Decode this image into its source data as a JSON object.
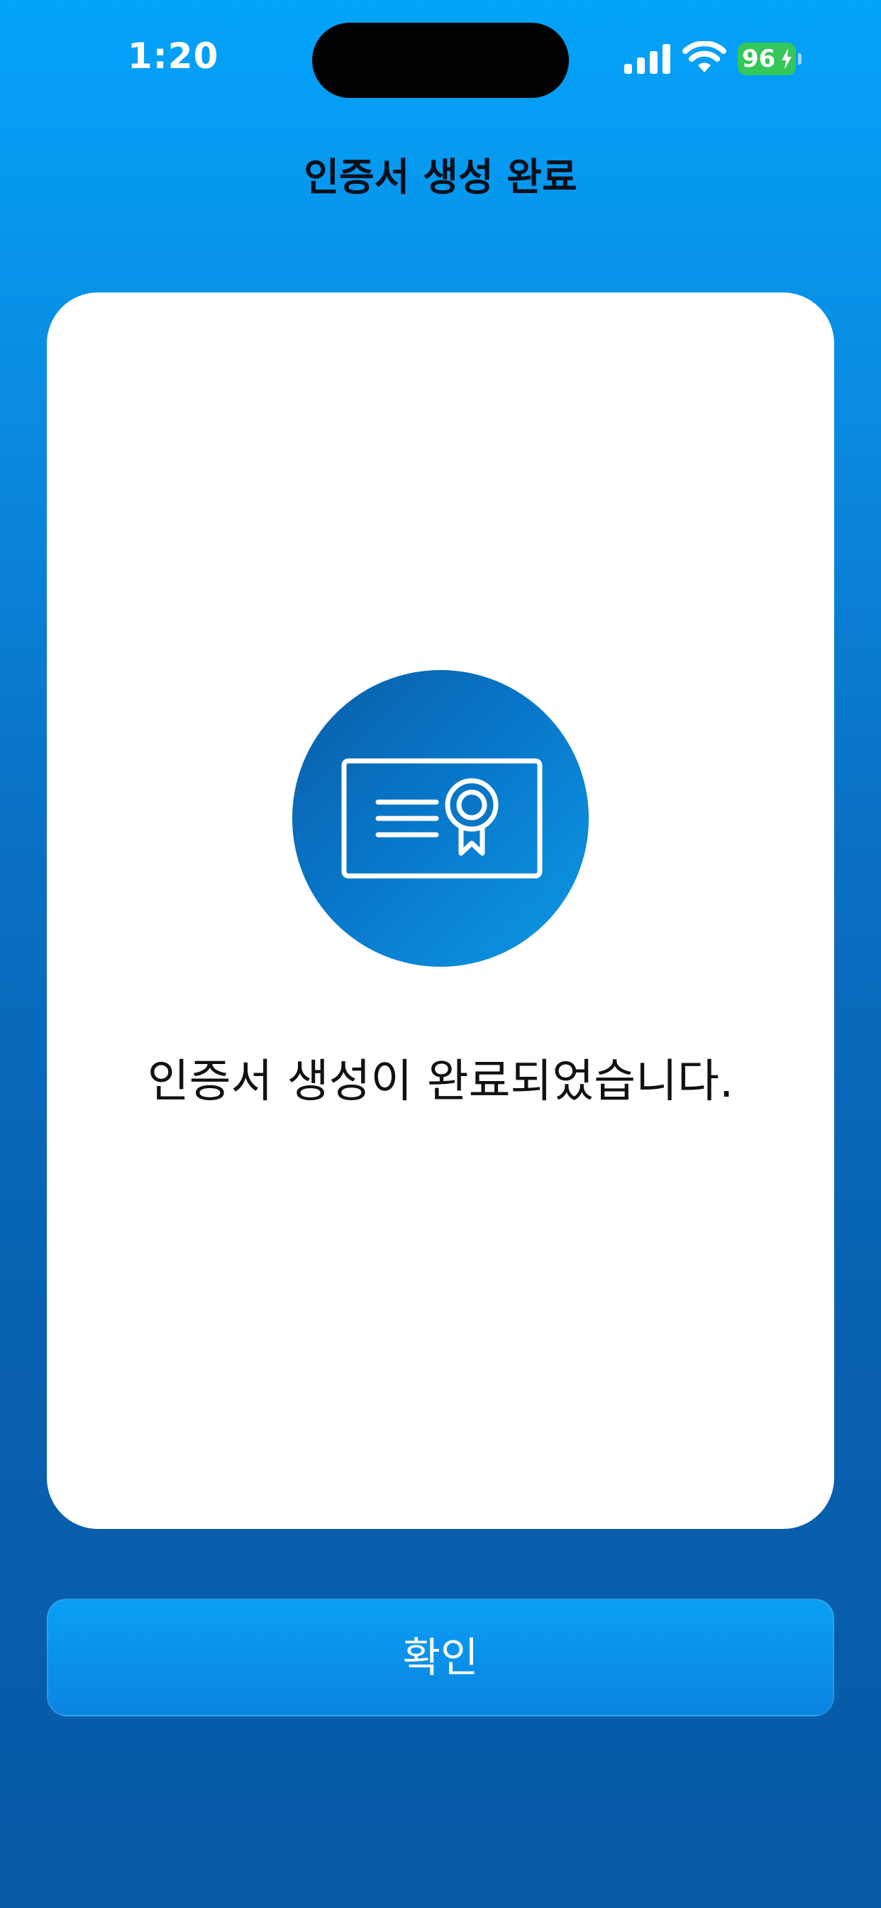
{
  "status_bar": {
    "time": "1:20",
    "battery_level": "96",
    "battery_charging": true,
    "signal_icon": "cellular-signal-icon",
    "wifi_icon": "wifi-icon"
  },
  "header": {
    "title": "인증서 생성 완료"
  },
  "card": {
    "icon": "certificate-icon",
    "message": "인증서 생성이 완료되었습니다."
  },
  "actions": {
    "confirm_label": "확인"
  },
  "colors": {
    "background_top": "#03a3fa",
    "background_bottom": "#075aa6",
    "card": "#ffffff",
    "badge": "#0876c8",
    "button": "#0a8ce6",
    "battery": "#34c759"
  }
}
